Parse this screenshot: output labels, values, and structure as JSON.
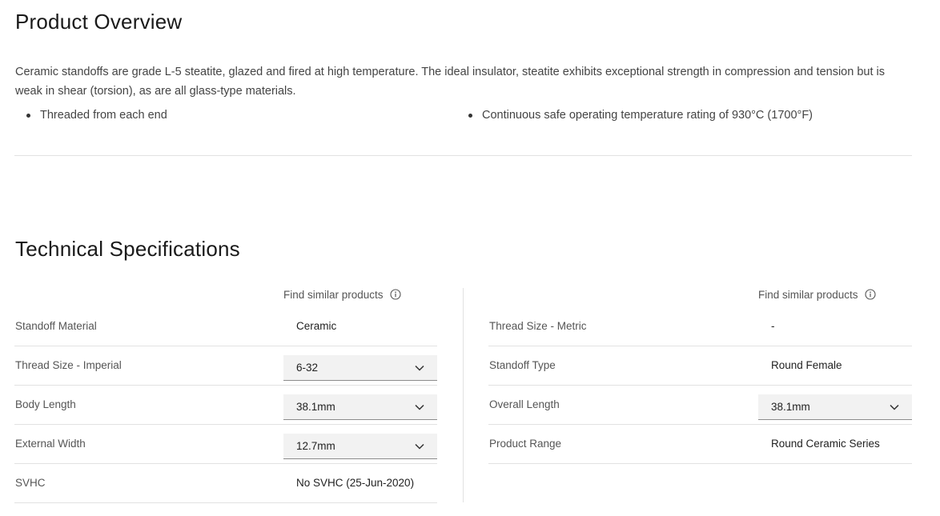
{
  "overview": {
    "title": "Product Overview",
    "description": "Ceramic standoffs are grade L-5 steatite, glazed and fired at high temperature. The ideal insulator, steatite exhibits exceptional strength in compression and tension but is weak in shear (torsion), as are all glass-type materials.",
    "bullets": [
      "Threaded from each end",
      "Continuous safe operating temperature rating of 930°C (1700°F)"
    ]
  },
  "specs": {
    "title": "Technical Specifications",
    "find_similar_label": "Find similar products",
    "left": [
      {
        "label": "Standoff Material",
        "value": "Ceramic",
        "type": "text"
      },
      {
        "label": "Thread Size - Imperial",
        "value": "6-32",
        "type": "select"
      },
      {
        "label": "Body Length",
        "value": "38.1mm",
        "type": "select"
      },
      {
        "label": "External Width",
        "value": "12.7mm",
        "type": "select"
      },
      {
        "label": "SVHC",
        "value": "No SVHC (25-Jun-2020)",
        "type": "text"
      }
    ],
    "right": [
      {
        "label": "Thread Size - Metric",
        "value": "-",
        "type": "text"
      },
      {
        "label": "Standoff Type",
        "value": "Round Female",
        "type": "text"
      },
      {
        "label": "Overall Length",
        "value": "38.1mm",
        "type": "select"
      },
      {
        "label": "Product Range",
        "value": "Round Ceramic Series",
        "type": "text"
      }
    ]
  },
  "icons": {
    "info": "info-circle-icon",
    "chevron": "chevron-down-icon"
  }
}
